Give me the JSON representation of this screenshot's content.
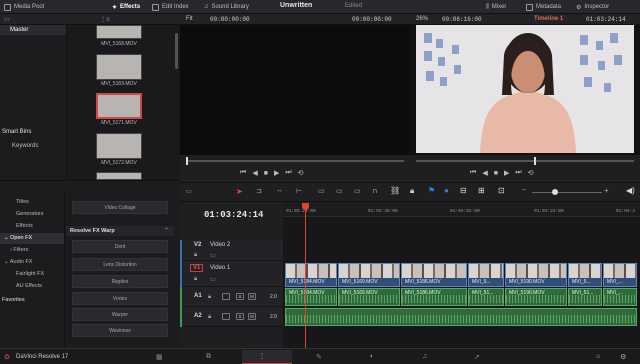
{
  "topbar": {
    "media_pool": "Media Pool",
    "effects": "Effects",
    "edit_index": "Edit Index",
    "sound_library": "Sound Library",
    "project_title": "Unwritten",
    "edited": "Edited",
    "mixer": "Mixer",
    "metadata": "Metadata",
    "inspector": "Inspector"
  },
  "source_viewer": {
    "fit": "Fit",
    "timecode_left": "00:00:00:00",
    "timecode_right": "00:00:00:00"
  },
  "timeline_viewer": {
    "zoom": "26%",
    "duration": "00:06:16:00",
    "timeline_name": "Timeline 1",
    "timecode": "01:03:24:14"
  },
  "media_pool": {
    "bins": [
      "Master"
    ],
    "smart_bins_label": "Smart Bins",
    "smart_bins": [
      "Keywords"
    ],
    "clips": [
      "MVI_5168.MOV",
      "MVI_5169.MOV",
      "MVI_5171.MOV",
      "MVI_5172.MOV"
    ]
  },
  "effects": {
    "categories": [
      "Titles",
      "Generators",
      "Effects",
      "Open FX",
      "Filters",
      "Audio FX",
      "Fairlight FX",
      "AU Effects"
    ],
    "favorites": "Favorites",
    "top_item": "Video Collage",
    "section": "Resolve FX Warp",
    "items": [
      "Dent",
      "Lens Distortion",
      "Ripples",
      "Vortex",
      "Warper",
      "Waviness"
    ]
  },
  "timeline": {
    "timecode": "01:03:24:14",
    "ruler": [
      "01:03:24:00",
      "01:03:48:00",
      "01:04:02:00",
      "01:04:24:00",
      "01:04:4"
    ],
    "tracks": {
      "v2": {
        "id": "V2",
        "name": "Video 2"
      },
      "v1": {
        "id": "V1",
        "name": "Video 1"
      },
      "a1": {
        "id": "A1",
        "level": "2.0"
      },
      "a2": {
        "id": "A2",
        "level": "2.0"
      }
    },
    "video_clips": [
      "MVI_5184.MOV",
      "MVI_5169.MOV",
      "MVI_5186.MOV",
      "MVI_5...",
      "MVI_5190.MOV",
      "MVI_5...",
      "MVI_..."
    ],
    "audio_clips": [
      "MVI_5184.MOV",
      "MVI_5169.MOV",
      "MVI_5186.MOV",
      "MVI_51...",
      "MVI_5190.MOV",
      "MVI_51...",
      "MVI_..."
    ]
  },
  "app": {
    "name": "DaVinci Resolve 17"
  },
  "colors": {
    "accent": "#d04545",
    "video_clip": "#2f4f7a",
    "audio_clip": "#2f6b3a",
    "playhead": "#e0403a"
  }
}
